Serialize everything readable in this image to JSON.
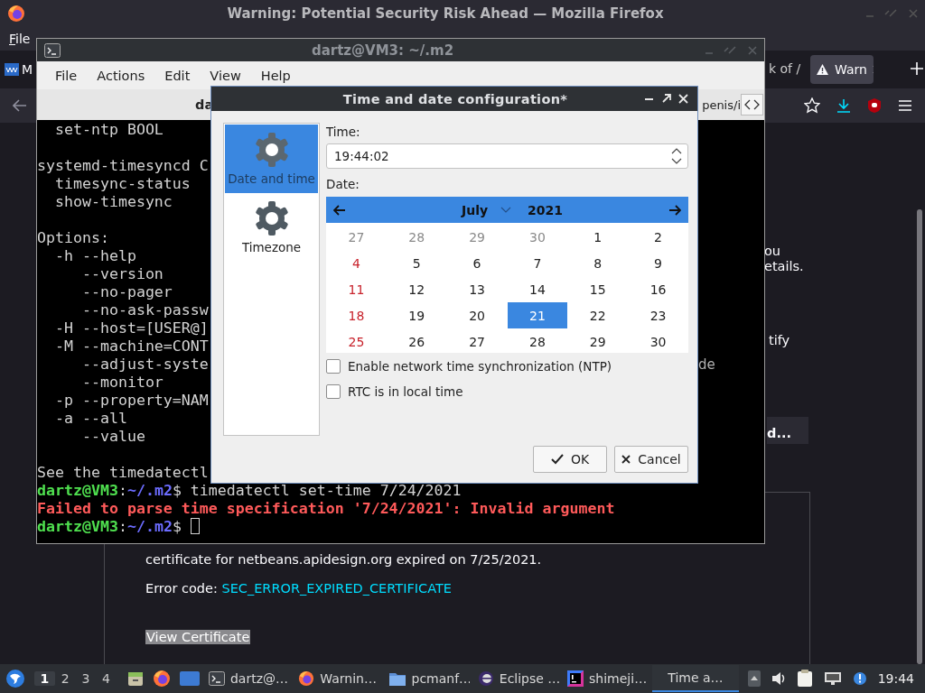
{
  "firefox": {
    "title": "Warning: Potential Security Risk Ahead — Mozilla Firefox",
    "menu": [
      "File"
    ],
    "tabs": [
      {
        "label": "M",
        "selected": false
      },
      {
        "label": "k of /",
        "selected": false
      },
      {
        "label": "Warn",
        "selected": true
      }
    ],
    "page": {
      "fragments": [
        "ou",
        "etails.",
        "tify"
      ],
      "button_fragment": "d...",
      "certificate_text": "certificate for netbeans.apidesign.org expired on 7/25/2021.",
      "error_label": "Error code:",
      "error_code": "SEC_ERROR_EXPIRED_CERTIFICATE",
      "view_certificate": "View Certificate"
    }
  },
  "terminal": {
    "title": "dartz@VM3: ~/.m2",
    "menu": [
      "File",
      "Actions",
      "Edit",
      "View",
      "Help"
    ],
    "tabs": [
      "da",
      "penis/i"
    ],
    "lines": [
      {
        "kind": "plain",
        "text": "  set-ntp BOOL"
      },
      {
        "kind": "blank"
      },
      {
        "kind": "plain",
        "text": "systemd-timesyncd C"
      },
      {
        "kind": "plain",
        "text": "  timesync-status"
      },
      {
        "kind": "plain",
        "text": "  show-timesync"
      },
      {
        "kind": "blank"
      },
      {
        "kind": "plain",
        "text": "Options:"
      },
      {
        "kind": "plain",
        "text": "  -h --help"
      },
      {
        "kind": "plain",
        "text": "     --version"
      },
      {
        "kind": "plain",
        "text": "     --no-pager"
      },
      {
        "kind": "plain",
        "text": "     --no-ask-passw"
      },
      {
        "kind": "plain",
        "text": "  -H --host=[USER@]"
      },
      {
        "kind": "plain",
        "text": "  -M --machine=CONT"
      },
      {
        "kind": "plain",
        "text": "     --adjust-syste"
      },
      {
        "kind": "plain",
        "text": "     --monitor"
      },
      {
        "kind": "plain",
        "text": "  -p --property=NAM"
      },
      {
        "kind": "plain",
        "text": "  -a --all"
      },
      {
        "kind": "plain",
        "text": "     --value"
      },
      {
        "kind": "blank"
      },
      {
        "kind": "plain",
        "text": "See the timedatectl"
      },
      {
        "kind": "prompt",
        "user": "dartz@VM3",
        "separator": ":",
        "path": "~/.m2",
        "symbol": "$",
        "command": "timedatectl set-time 7/24/2021",
        "cursor": false
      },
      {
        "kind": "error",
        "text": "Failed to parse time specification '7/24/2021': Invalid argument"
      },
      {
        "kind": "prompt",
        "user": "dartz@VM3",
        "separator": ":",
        "path": "~/.m2",
        "symbol": "$",
        "cursor": true
      }
    ],
    "peek_text": "de"
  },
  "dialog": {
    "title": "Time and date configuration*",
    "sidebar": [
      {
        "label": "Date and time",
        "selected": true
      },
      {
        "label": "Timezone",
        "selected": false
      }
    ],
    "time_label": "Time:",
    "time_value": "19:44:02",
    "date_label": "Date:",
    "month": "July",
    "year": "2021",
    "days": [
      {
        "label": "27",
        "kind": "other",
        "selected": false
      },
      {
        "label": "28",
        "kind": "other",
        "selected": false
      },
      {
        "label": "29",
        "kind": "other",
        "selected": false
      },
      {
        "label": "30",
        "kind": "other",
        "selected": false
      },
      {
        "label": "1",
        "kind": "day",
        "selected": false
      },
      {
        "label": "2",
        "kind": "day",
        "selected": false
      },
      {
        "label": "4",
        "kind": "sunday",
        "selected": false
      },
      {
        "label": "5",
        "kind": "day",
        "selected": false
      },
      {
        "label": "6",
        "kind": "day",
        "selected": false
      },
      {
        "label": "7",
        "kind": "day",
        "selected": false
      },
      {
        "label": "8",
        "kind": "day",
        "selected": false
      },
      {
        "label": "9",
        "kind": "day",
        "selected": false
      },
      {
        "label": "11",
        "kind": "sunday",
        "selected": false
      },
      {
        "label": "12",
        "kind": "day",
        "selected": false
      },
      {
        "label": "13",
        "kind": "day",
        "selected": false
      },
      {
        "label": "14",
        "kind": "day",
        "selected": false
      },
      {
        "label": "15",
        "kind": "day",
        "selected": false
      },
      {
        "label": "16",
        "kind": "day",
        "selected": false
      },
      {
        "label": "18",
        "kind": "sunday",
        "selected": false
      },
      {
        "label": "19",
        "kind": "day",
        "selected": false
      },
      {
        "label": "20",
        "kind": "day",
        "selected": false
      },
      {
        "label": "21",
        "kind": "day",
        "selected": true
      },
      {
        "label": "22",
        "kind": "day",
        "selected": false
      },
      {
        "label": "23",
        "kind": "day",
        "selected": false
      },
      {
        "label": "25",
        "kind": "sunday",
        "selected": false
      },
      {
        "label": "26",
        "kind": "day",
        "selected": false
      },
      {
        "label": "27",
        "kind": "day",
        "selected": false
      },
      {
        "label": "28",
        "kind": "day",
        "selected": false
      },
      {
        "label": "29",
        "kind": "day",
        "selected": false
      },
      {
        "label": "30",
        "kind": "day",
        "selected": false
      }
    ],
    "options": [
      {
        "label": "Enable network time synchronization (NTP)",
        "checked": false
      },
      {
        "label": "RTC is in local time",
        "checked": false
      }
    ],
    "buttons": [
      {
        "label": "OK",
        "kind": "ok"
      },
      {
        "label": "Cancel",
        "kind": "cancel"
      }
    ]
  },
  "taskbar": {
    "workspaces": [
      {
        "label": "1",
        "selected": true
      },
      {
        "label": "2",
        "selected": false
      },
      {
        "label": "3",
        "selected": false
      },
      {
        "label": "4",
        "selected": false
      }
    ],
    "tasks": [
      {
        "label": "dartz@…",
        "kind": "terminal",
        "selected": false
      },
      {
        "label": "Warnin…",
        "kind": "firefox",
        "selected": false
      },
      {
        "label": "pcmanf…",
        "kind": "folder",
        "selected": false
      },
      {
        "label": "Eclipse …",
        "kind": "eclipse",
        "selected": false
      },
      {
        "label": "shimeji…",
        "kind": "intellij",
        "selected": false
      },
      {
        "label": "Time a…",
        "kind": "window",
        "selected": true
      }
    ],
    "clock": "19:44"
  }
}
